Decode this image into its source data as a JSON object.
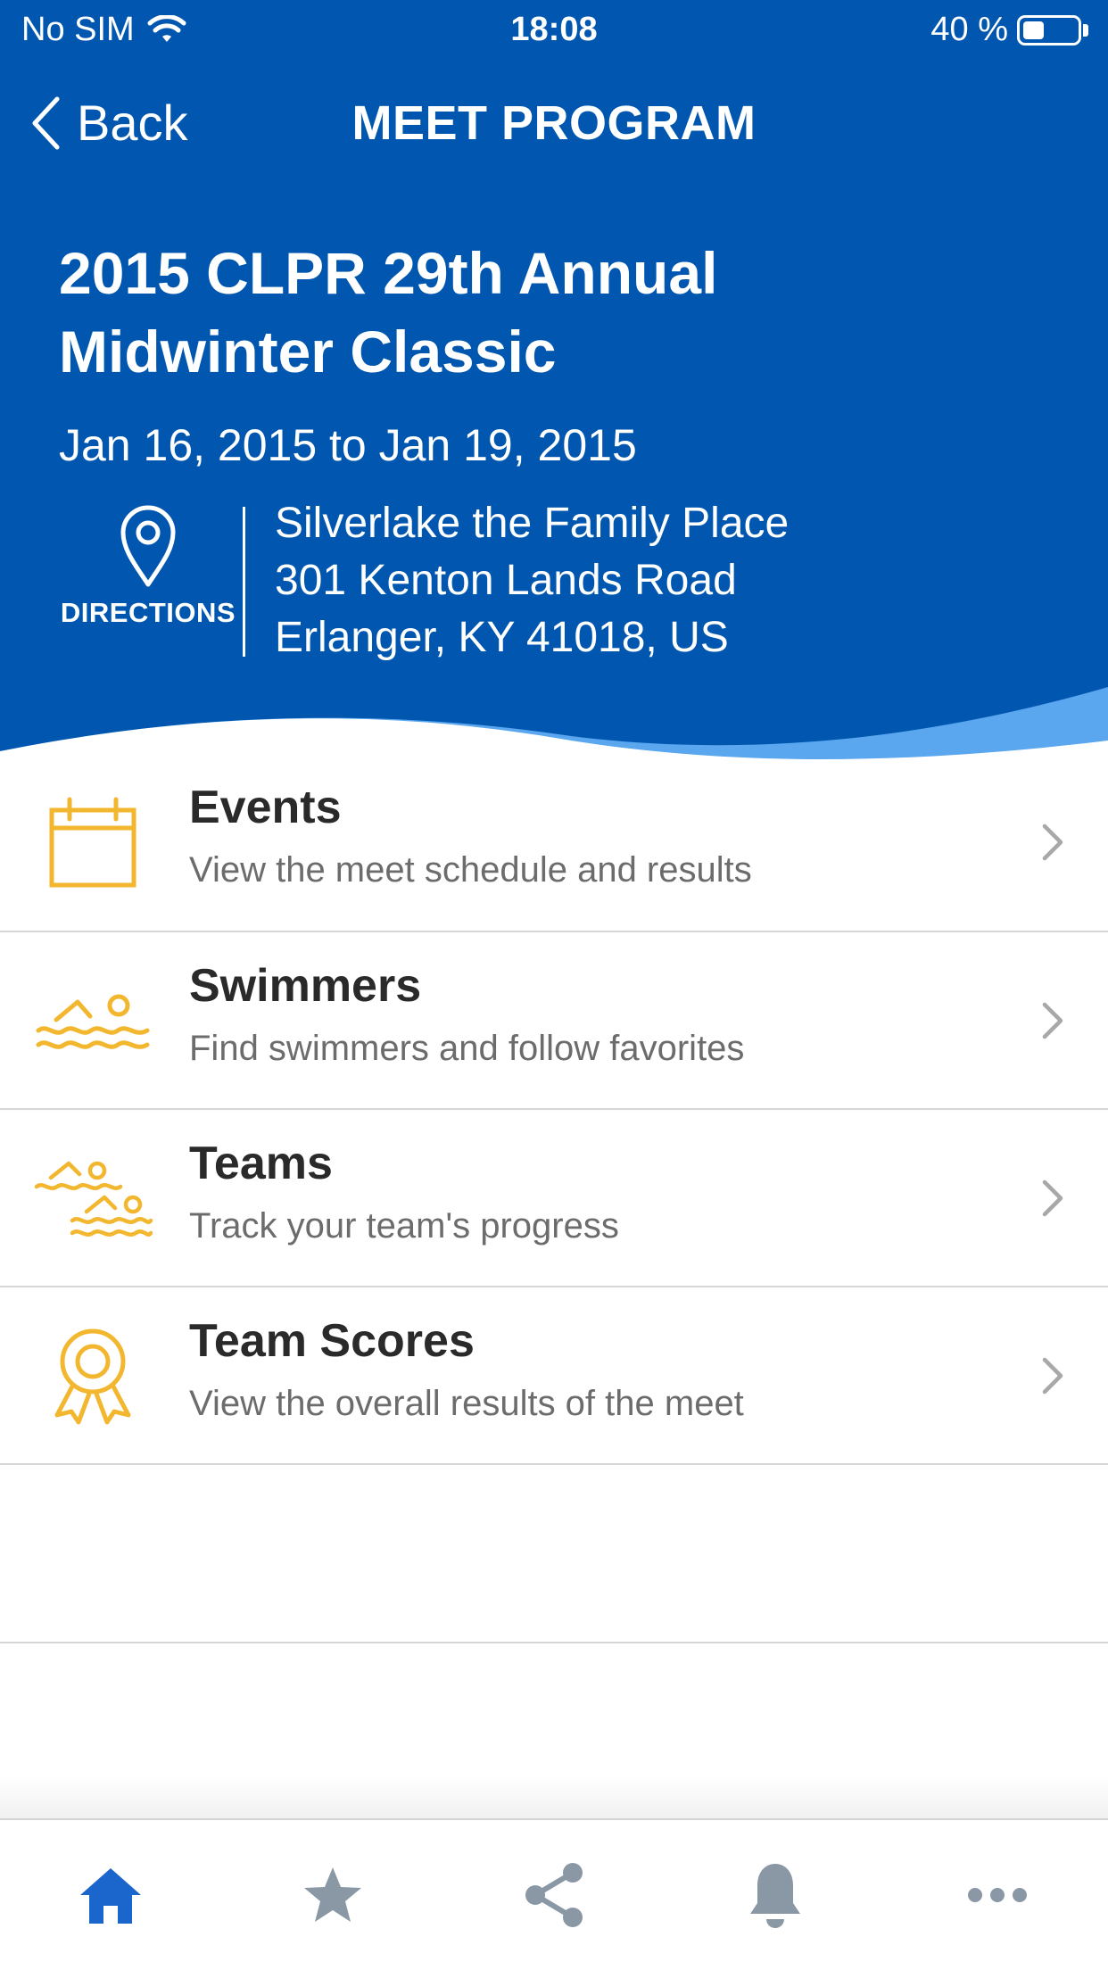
{
  "status_bar": {
    "carrier": "No SIM",
    "time": "18:08",
    "battery": "40 %",
    "battery_level": 0.4
  },
  "nav": {
    "back_label": "Back",
    "title": "MEET PROGRAM"
  },
  "meet": {
    "title_line1": "2015 CLPR 29th Annual",
    "title_line2": "Midwinter Classic",
    "dates": "Jan 16, 2015 to Jan 19, 2015",
    "directions_label": "DIRECTIONS",
    "address": [
      "Silverlake the Family Place",
      "301 Kenton Lands Road",
      "Erlanger, KY 41018, US"
    ]
  },
  "menu": [
    {
      "title": "Events",
      "subtitle": "View the meet schedule and results",
      "icon": "calendar-icon"
    },
    {
      "title": "Swimmers",
      "subtitle": "Find swimmers and follow favorites",
      "icon": "swimmer-icon"
    },
    {
      "title": "Teams",
      "subtitle": "Track your team's progress",
      "icon": "team-swimmers-icon"
    },
    {
      "title": "Team Scores",
      "subtitle": "View the overall results of the meet",
      "icon": "award-ribbon-icon"
    }
  ],
  "tabs": [
    {
      "name": "home",
      "icon": "home-icon",
      "active": true
    },
    {
      "name": "favorites",
      "icon": "star-icon",
      "active": false
    },
    {
      "name": "share",
      "icon": "share-icon",
      "active": false
    },
    {
      "name": "notifications",
      "icon": "bell-icon",
      "active": false
    },
    {
      "name": "more",
      "icon": "more-icon",
      "active": false
    }
  ],
  "colors": {
    "header_blue": "#0157b0",
    "wave_light": "#5aa6ef",
    "accent_yellow": "#f3b72f",
    "tab_active": "#1a66cc",
    "tab_inactive": "#8a98a6"
  }
}
